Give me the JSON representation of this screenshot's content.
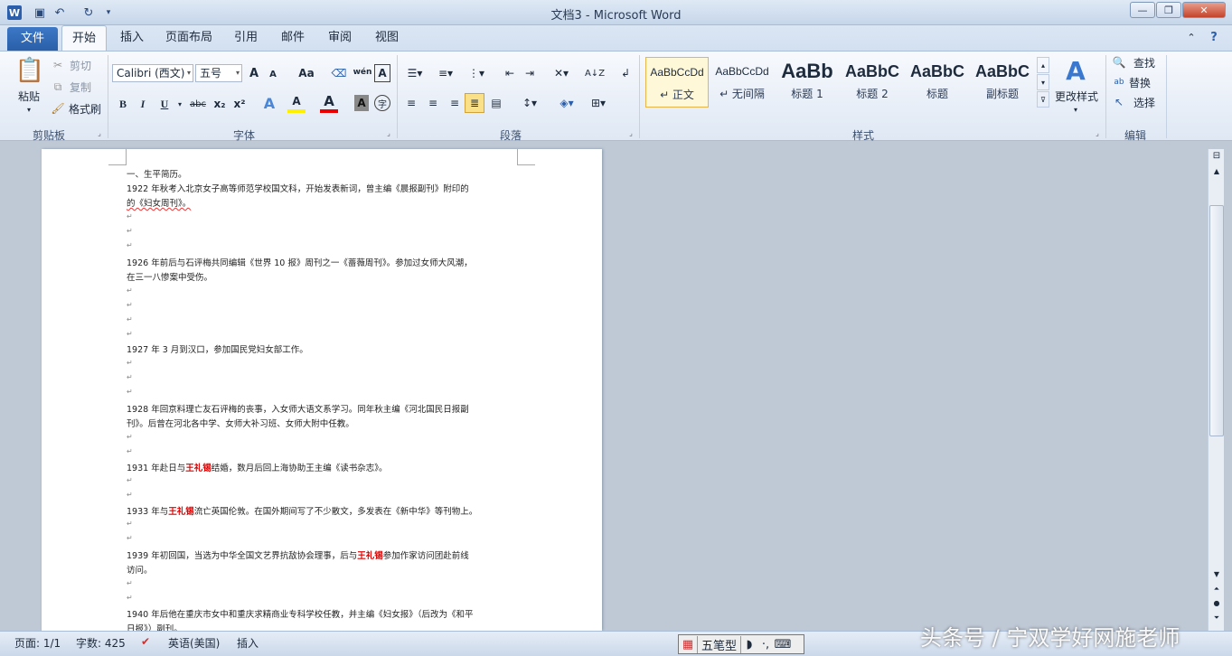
{
  "titlebar": {
    "title": "文档3 -  Microsoft Word",
    "app_icon": "W"
  },
  "window": {
    "minimize": "—",
    "restore": "❐",
    "close": "✕"
  },
  "tabs": [
    "文件",
    "开始",
    "插入",
    "页面布局",
    "引用",
    "邮件",
    "审阅",
    "视图"
  ],
  "clipboard": {
    "paste": "粘贴",
    "cut": "剪切",
    "copy": "复制",
    "format_painter": "格式刷",
    "label": "剪贴板"
  },
  "font": {
    "name": "Calibri (西文)",
    "size": "五号",
    "label": "字体",
    "bold": "B",
    "italic": "I",
    "underline": "U",
    "strike": "abc",
    "sub": "x₂",
    "sup": "x²",
    "grow": "A",
    "shrink": "A",
    "case": "Aa",
    "phonetic": "wén",
    "border": "A",
    "highlight": "A",
    "color": "A",
    "shade": "A",
    "enclose": "字"
  },
  "paragraph": {
    "label": "段落"
  },
  "styles": {
    "label": "样式",
    "items": [
      {
        "preview": "AaBbCcDd",
        "name": "↵ 正文"
      },
      {
        "preview": "AaBbCcDd",
        "name": "↵ 无间隔"
      },
      {
        "preview": "AaBb",
        "name": "标题 1"
      },
      {
        "preview": "AaBbC",
        "name": "标题 2"
      },
      {
        "preview": "AaBbC",
        "name": "标题"
      },
      {
        "preview": "AaBbC",
        "name": "副标题"
      }
    ],
    "change": "更改样式"
  },
  "editing": {
    "label": "编辑",
    "find": "查找",
    "replace": "替换",
    "select": "选择"
  },
  "document": {
    "lines": [
      {
        "text": "一、生平简历。"
      },
      {
        "text": "1922 年秋考入北京女子高等师范学校国文科，开始发表新词，曾主编《晨报副刊》附印的"
      },
      {
        "text": "的《妇女周刊》。"
      },
      {
        "text": "1926 年前后与石评梅共同编辑《世界 10 报》周刊之一《蔷薇周刊》。参加过女师大风潮，"
      },
      {
        "text": "在三一八惨案中受伤。"
      },
      {
        "text": "1927 年 3 月到汉口，参加国民党妇女部工作。"
      },
      {
        "text": "1928 年回京料理亡友石评梅的丧事，入女师大语文系学习。同年秋主编《河北国民日报副"
      },
      {
        "text": "刊》。后曾在河北各中学、女师大补习班、女师大附中任教。"
      },
      {
        "pre": "1931 年赴日与",
        "red": "王礼锡",
        "post": "结婚，数月后回上海协助王主编《读书杂志》。"
      },
      {
        "pre": "1933 年与",
        "red": "王礼锡",
        "post": "流亡英国伦敦。在国外期间写了不少散文，多发表在《新中华》等刊物上。"
      },
      {
        "pre": "1939 年初回国，当选为中华全国文艺界抗敌协会理事，后与",
        "red": "王礼锡",
        "post": "参加作家访问团赴前线"
      },
      {
        "text": "访问。"
      },
      {
        "text": "1940 年后他在重庆市女中和重庆求精商业专科学校任教，并主编《妇女报》（后改为《和平"
      },
      {
        "text": "日报》）副刊。"
      }
    ]
  },
  "status": {
    "page": "页面: 1/1",
    "words": "字数: 425",
    "lang": "英语(美国)",
    "mode": "插入"
  },
  "ime": {
    "name": "五笔型"
  },
  "watermark": "头条号 / 宁双学好网施老师"
}
